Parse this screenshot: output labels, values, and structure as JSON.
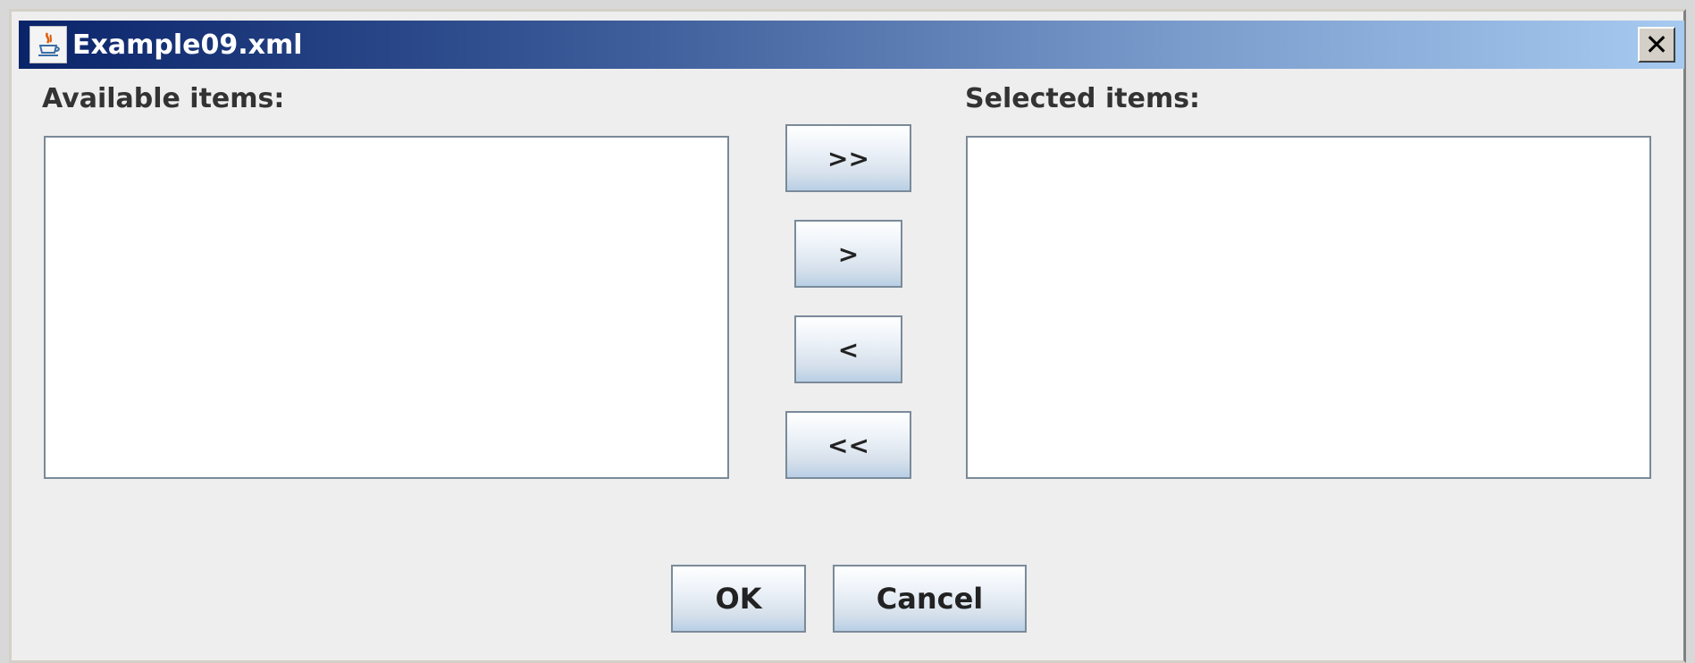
{
  "window": {
    "title": "Example09.xml",
    "close_label": "✕"
  },
  "available": {
    "label": "Available items:",
    "items": []
  },
  "selected": {
    "label": "Selected items:",
    "items": []
  },
  "transfer_buttons": {
    "add_all": ">>",
    "add": ">",
    "remove": "<",
    "remove_all": "<<"
  },
  "footer": {
    "ok": "OK",
    "cancel": "Cancel"
  },
  "icons": {
    "app": "java-cup-icon",
    "close": "close-icon"
  }
}
